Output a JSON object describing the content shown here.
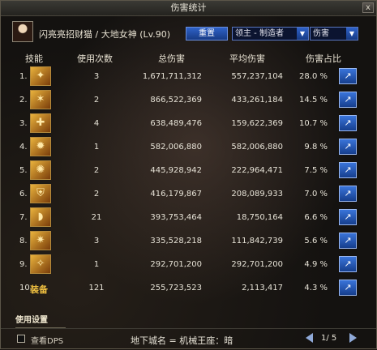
{
  "window": {
    "title": "伤害统计",
    "close_label": "x"
  },
  "header": {
    "character": "闪亮亮招财猫 / 大地女神 (Lv.90)",
    "reset_label": "重置",
    "dungeon_select": "领主 - 制造者",
    "type_select": "伤害"
  },
  "table": {
    "columns": [
      "技能",
      "使用次数",
      "总伤害",
      "平均伤害",
      "伤害占比"
    ],
    "rows": [
      {
        "index": "1.",
        "icon": "skill-1-icon",
        "uses": "3",
        "total": "1,671,711,312",
        "avg": "557,237,104",
        "pct": "28.0 %"
      },
      {
        "index": "2.",
        "icon": "skill-2-icon",
        "uses": "2",
        "total": "866,522,369",
        "avg": "433,261,184",
        "pct": "14.5 %"
      },
      {
        "index": "3.",
        "icon": "skill-3-icon",
        "uses": "4",
        "total": "638,489,476",
        "avg": "159,622,369",
        "pct": "10.7 %"
      },
      {
        "index": "4.",
        "icon": "skill-4-icon",
        "uses": "1",
        "total": "582,006,880",
        "avg": "582,006,880",
        "pct": "9.8 %"
      },
      {
        "index": "5.",
        "icon": "skill-5-icon",
        "uses": "2",
        "total": "445,928,942",
        "avg": "222,964,471",
        "pct": "7.5 %"
      },
      {
        "index": "6.",
        "icon": "skill-6-icon",
        "uses": "2",
        "total": "416,179,867",
        "avg": "208,089,933",
        "pct": "7.0 %"
      },
      {
        "index": "7.",
        "icon": "skill-7-icon",
        "uses": "21",
        "total": "393,753,464",
        "avg": "18,750,164",
        "pct": "6.6 %"
      },
      {
        "index": "8.",
        "icon": "skill-8-icon",
        "uses": "3",
        "total": "335,528,218",
        "avg": "111,842,739",
        "pct": "5.6 %"
      },
      {
        "index": "9.",
        "icon": "skill-9-icon",
        "uses": "1",
        "total": "292,701,200",
        "avg": "292,701,200",
        "pct": "4.9 %"
      },
      {
        "index": "10.",
        "equip": "装备",
        "uses": "121",
        "total": "255,723,523",
        "avg": "2,113,417",
        "pct": "4.3 %"
      }
    ]
  },
  "footer": {
    "settings_tab": "使用设置",
    "view_dps_label": "查看DPS",
    "location": "地下城名 = 机械王座：暗",
    "page": "1/ 5"
  }
}
